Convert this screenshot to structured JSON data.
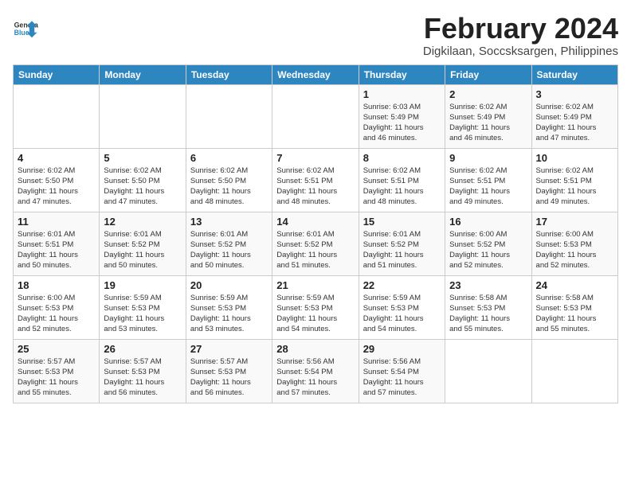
{
  "header": {
    "logo_line1": "General",
    "logo_line2": "Blue",
    "title": "February 2024",
    "subtitle": "Digkilaan, Soccsksargen, Philippines"
  },
  "weekdays": [
    "Sunday",
    "Monday",
    "Tuesday",
    "Wednesday",
    "Thursday",
    "Friday",
    "Saturday"
  ],
  "weeks": [
    [
      {
        "day": "",
        "info": ""
      },
      {
        "day": "",
        "info": ""
      },
      {
        "day": "",
        "info": ""
      },
      {
        "day": "",
        "info": ""
      },
      {
        "day": "1",
        "info": "Sunrise: 6:03 AM\nSunset: 5:49 PM\nDaylight: 11 hours\nand 46 minutes."
      },
      {
        "day": "2",
        "info": "Sunrise: 6:02 AM\nSunset: 5:49 PM\nDaylight: 11 hours\nand 46 minutes."
      },
      {
        "day": "3",
        "info": "Sunrise: 6:02 AM\nSunset: 5:49 PM\nDaylight: 11 hours\nand 47 minutes."
      }
    ],
    [
      {
        "day": "4",
        "info": "Sunrise: 6:02 AM\nSunset: 5:50 PM\nDaylight: 11 hours\nand 47 minutes."
      },
      {
        "day": "5",
        "info": "Sunrise: 6:02 AM\nSunset: 5:50 PM\nDaylight: 11 hours\nand 47 minutes."
      },
      {
        "day": "6",
        "info": "Sunrise: 6:02 AM\nSunset: 5:50 PM\nDaylight: 11 hours\nand 48 minutes."
      },
      {
        "day": "7",
        "info": "Sunrise: 6:02 AM\nSunset: 5:51 PM\nDaylight: 11 hours\nand 48 minutes."
      },
      {
        "day": "8",
        "info": "Sunrise: 6:02 AM\nSunset: 5:51 PM\nDaylight: 11 hours\nand 48 minutes."
      },
      {
        "day": "9",
        "info": "Sunrise: 6:02 AM\nSunset: 5:51 PM\nDaylight: 11 hours\nand 49 minutes."
      },
      {
        "day": "10",
        "info": "Sunrise: 6:02 AM\nSunset: 5:51 PM\nDaylight: 11 hours\nand 49 minutes."
      }
    ],
    [
      {
        "day": "11",
        "info": "Sunrise: 6:01 AM\nSunset: 5:51 PM\nDaylight: 11 hours\nand 50 minutes."
      },
      {
        "day": "12",
        "info": "Sunrise: 6:01 AM\nSunset: 5:52 PM\nDaylight: 11 hours\nand 50 minutes."
      },
      {
        "day": "13",
        "info": "Sunrise: 6:01 AM\nSunset: 5:52 PM\nDaylight: 11 hours\nand 50 minutes."
      },
      {
        "day": "14",
        "info": "Sunrise: 6:01 AM\nSunset: 5:52 PM\nDaylight: 11 hours\nand 51 minutes."
      },
      {
        "day": "15",
        "info": "Sunrise: 6:01 AM\nSunset: 5:52 PM\nDaylight: 11 hours\nand 51 minutes."
      },
      {
        "day": "16",
        "info": "Sunrise: 6:00 AM\nSunset: 5:52 PM\nDaylight: 11 hours\nand 52 minutes."
      },
      {
        "day": "17",
        "info": "Sunrise: 6:00 AM\nSunset: 5:53 PM\nDaylight: 11 hours\nand 52 minutes."
      }
    ],
    [
      {
        "day": "18",
        "info": "Sunrise: 6:00 AM\nSunset: 5:53 PM\nDaylight: 11 hours\nand 52 minutes."
      },
      {
        "day": "19",
        "info": "Sunrise: 5:59 AM\nSunset: 5:53 PM\nDaylight: 11 hours\nand 53 minutes."
      },
      {
        "day": "20",
        "info": "Sunrise: 5:59 AM\nSunset: 5:53 PM\nDaylight: 11 hours\nand 53 minutes."
      },
      {
        "day": "21",
        "info": "Sunrise: 5:59 AM\nSunset: 5:53 PM\nDaylight: 11 hours\nand 54 minutes."
      },
      {
        "day": "22",
        "info": "Sunrise: 5:59 AM\nSunset: 5:53 PM\nDaylight: 11 hours\nand 54 minutes."
      },
      {
        "day": "23",
        "info": "Sunrise: 5:58 AM\nSunset: 5:53 PM\nDaylight: 11 hours\nand 55 minutes."
      },
      {
        "day": "24",
        "info": "Sunrise: 5:58 AM\nSunset: 5:53 PM\nDaylight: 11 hours\nand 55 minutes."
      }
    ],
    [
      {
        "day": "25",
        "info": "Sunrise: 5:57 AM\nSunset: 5:53 PM\nDaylight: 11 hours\nand 55 minutes."
      },
      {
        "day": "26",
        "info": "Sunrise: 5:57 AM\nSunset: 5:53 PM\nDaylight: 11 hours\nand 56 minutes."
      },
      {
        "day": "27",
        "info": "Sunrise: 5:57 AM\nSunset: 5:53 PM\nDaylight: 11 hours\nand 56 minutes."
      },
      {
        "day": "28",
        "info": "Sunrise: 5:56 AM\nSunset: 5:54 PM\nDaylight: 11 hours\nand 57 minutes."
      },
      {
        "day": "29",
        "info": "Sunrise: 5:56 AM\nSunset: 5:54 PM\nDaylight: 11 hours\nand 57 minutes."
      },
      {
        "day": "",
        "info": ""
      },
      {
        "day": "",
        "info": ""
      }
    ]
  ]
}
